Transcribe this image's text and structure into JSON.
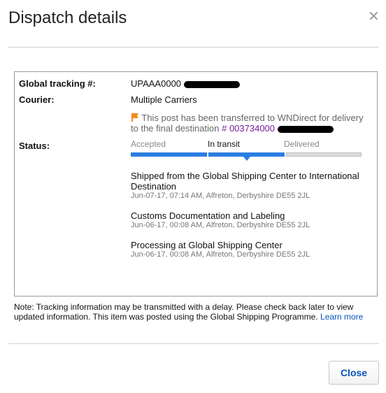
{
  "dialog": {
    "title": "Dispatch details"
  },
  "tracking": {
    "label": "Global tracking #:",
    "number_visible": "UPAAA0000",
    "courier_label": "Courier:",
    "courier_value": "Multiple Carriers",
    "notice_text": "This post has been transferred to WNDirect for delivery to the final destination",
    "notice_ref": "# 003734000",
    "status_label": "Status:"
  },
  "status_steps": [
    {
      "label": "Accepted",
      "state": "done"
    },
    {
      "label": "In transit",
      "state": "current"
    },
    {
      "label": "Delivered",
      "state": "pending"
    }
  ],
  "events": [
    {
      "title": "Shipped from the Global Shipping Center to International Destination",
      "meta": "Jun-07-17, 07:14 AM, Alfreton, Derbyshire DE55 2JL"
    },
    {
      "title": "Customs Documentation and Labeling",
      "meta": "Jun-06-17, 00:08 AM, Alfreton, Derbyshire DE55 2JL"
    },
    {
      "title": "Processing at Global Shipping Center",
      "meta": "Jun-06-17, 00:08 AM, Alfreton, Derbyshire DE55 2JL"
    }
  ],
  "note": {
    "text": "Note: Tracking information may be transmitted with a delay. Please check back later to view updated information. This item was posted using the Global Shipping Programme.",
    "link": "Learn more"
  },
  "footer": {
    "close_label": "Close"
  },
  "colors": {
    "accent": "#0654ba",
    "progress": "#2a7de1",
    "purple": "#7a1b98",
    "flag": "#f28a1b"
  },
  "icons": {
    "close": "close-icon",
    "flag": "flag-icon"
  }
}
